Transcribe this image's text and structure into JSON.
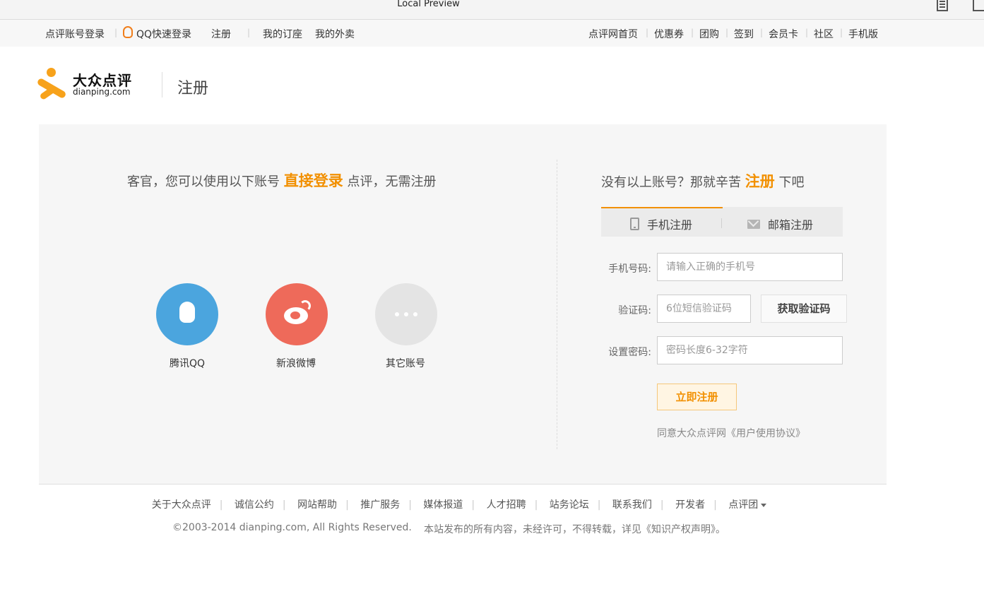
{
  "window": {
    "title": "Local Preview"
  },
  "topnav": {
    "left": {
      "account_login": "点评账号登录",
      "qq_login": "QQ快速登录",
      "register": "注册",
      "my_orders": "我的订座",
      "my_takeout": "我的外卖"
    },
    "right": [
      "点评网首页",
      "优惠券",
      "团购",
      "签到",
      "会员卡",
      "社区",
      "手机版"
    ]
  },
  "header": {
    "logo_cn": "大众点评",
    "logo_en": "dianping.com",
    "page_title": "注册"
  },
  "left_panel": {
    "headline_pre": "客官，您可以使用以下账号",
    "headline_highlight": "直接登录",
    "headline_post": "点评，无需注册",
    "social": [
      {
        "label": "腾讯QQ",
        "icon": "qq-icon"
      },
      {
        "label": "新浪微博",
        "icon": "weibo-icon"
      },
      {
        "label": "其它账号",
        "icon": "more-icon"
      }
    ]
  },
  "right_panel": {
    "headline_pre": "没有以上账号？那就辛苦",
    "headline_highlight": "注册",
    "headline_post": "下吧",
    "tabs": [
      {
        "label": "手机注册",
        "icon": "phone-icon",
        "active": true
      },
      {
        "label": "邮箱注册",
        "icon": "mail-icon",
        "active": false
      }
    ],
    "form": {
      "phone_label": "手机号码:",
      "phone_placeholder": "请输入正确的手机号",
      "code_label": "验证码:",
      "code_placeholder": "6位短信验证码",
      "get_code_button": "获取验证码",
      "password_label": "设置密码:",
      "password_placeholder": "密码长度6-32字符",
      "submit_button": "立即注册",
      "agreement": "同意大众点评网《用户使用协议》"
    }
  },
  "footer": {
    "links": [
      "关于大众点评",
      "诚信公约",
      "网站帮助",
      "推广服务",
      "媒体报道",
      "人才招聘",
      "站务论坛",
      "联系我们",
      "开发者",
      "点评团"
    ],
    "copyright": "©2003-2014 dianping.com, All Rights Reserved.",
    "notice": "本站发布的所有内容，未经许可，不得转载，详见《知识产权声明》。"
  },
  "colors": {
    "accent": "#f29001",
    "qq": "#4ba5de",
    "weibo": "#ee6a5a",
    "panel_bg": "#f6f6f6"
  }
}
